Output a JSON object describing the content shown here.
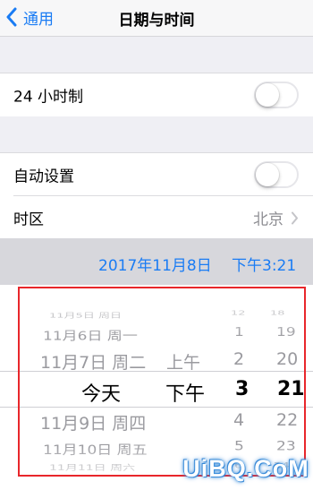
{
  "nav": {
    "back_label": "通用",
    "title": "日期与时间"
  },
  "settings": {
    "hour24": {
      "label": "24 小时制",
      "on": false
    },
    "auto_set": {
      "label": "自动设置",
      "on": false
    },
    "timezone": {
      "label": "时区",
      "value": "北京"
    }
  },
  "date_display": {
    "date": "2017年11月8日",
    "time": "下午3:21"
  },
  "picker": {
    "date_column": [
      "11月5日 周日",
      "11月6日 周一",
      "11月7日 周二",
      "今天",
      "11月9日 周四",
      "11月10日 周五",
      "11月11日 周六"
    ],
    "ampm_column": [
      "上午",
      "下午"
    ],
    "hour_column": [
      "12",
      "1",
      "2",
      "3",
      "4",
      "5",
      "6"
    ],
    "minute_column": [
      "18",
      "19",
      "20",
      "21",
      "22",
      "23",
      "24"
    ],
    "selected": {
      "date": "今天",
      "ampm": "下午",
      "hour": "3",
      "minute": "21"
    }
  },
  "watermark": "UiBQ.CoM",
  "colors": {
    "accent": "#1a7cf4",
    "highlight_border": "#e8262b"
  }
}
